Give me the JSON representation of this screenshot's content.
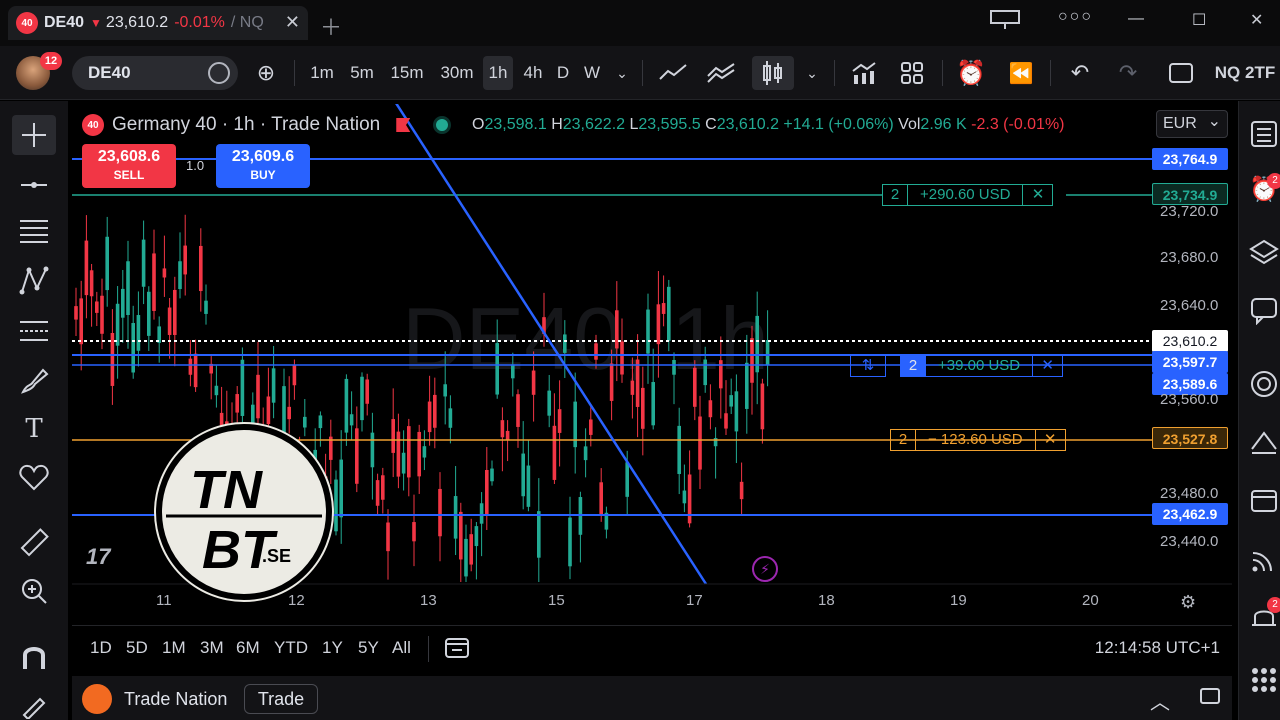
{
  "browser_tab": {
    "badge": "40",
    "symbol": "DE40",
    "price": "23,610.2",
    "change": "-0.01%",
    "suffix": "/ NQ"
  },
  "toolbar": {
    "notif_count": "12",
    "symbol": "DE40",
    "intervals": [
      "1m",
      "5m",
      "15m",
      "30m",
      "1h",
      "4h",
      "D",
      "W"
    ],
    "active_interval": "1h",
    "right_label": "NQ 2TF"
  },
  "chart": {
    "legend_badge": "40",
    "title": "Germany 40 · 1h · Trade Nation",
    "ohlc": {
      "o_label": "O",
      "o": "23,598.1",
      "h_label": "H",
      "h": "23,622.2",
      "l_label": "L",
      "l": "23,595.5",
      "c_label": "C",
      "c": "23,610.2",
      "chg": "+14.1 (+0.06%)",
      "vol_label": "Vol",
      "vol": "2.96 K",
      "vol_chg": "-2.3 (-0.01%)"
    },
    "currency": "EUR",
    "sell": {
      "price": "23,608.6",
      "label": "SELL"
    },
    "buy": {
      "price": "23,609.6",
      "label": "BUY"
    },
    "quantity": "1.0",
    "watermark": "DE40, 1h",
    "orders": [
      {
        "qty": "2",
        "pl": "+290.60 USD",
        "close": "✕",
        "color": "#22ab94"
      },
      {
        "qty": "2",
        "pl": "+39.00 USD",
        "close": "✕",
        "color": "#2962ff"
      },
      {
        "qty": "2",
        "pl": "− 123.60 USD",
        "close": "✕",
        "color": "#f0a030"
      }
    ],
    "price_tags": [
      {
        "value": "23,764.9",
        "color": "#2962ff"
      },
      {
        "value": "23,734.9",
        "color": "#1b4d3e"
      },
      {
        "value": "23,610.2",
        "color": "#ffffff"
      },
      {
        "value": "23,597.7",
        "color": "#2962ff"
      },
      {
        "value": "23,589.6",
        "color": "#2962ff"
      },
      {
        "value": "23,527.8",
        "color": "#f0a030"
      },
      {
        "value": "23,462.9",
        "color": "#2962ff"
      }
    ],
    "y_ticks": [
      "23,720.0",
      "23,680.0",
      "23,640.0",
      "23,560.0",
      "23,480.0",
      "23,440.0"
    ],
    "x_ticks": [
      "11",
      "12",
      "13",
      "15",
      "17",
      "18",
      "19",
      "20"
    ],
    "tv_logo": "17",
    "logo_text": {
      "line1": "TN",
      "line2": "BT",
      "suffix": ".SE"
    }
  },
  "range_bar": {
    "ranges": [
      "1D",
      "5D",
      "1M",
      "3M",
      "6M",
      "YTD",
      "1Y",
      "5Y",
      "All"
    ],
    "clock": "12:14:58 UTC+1"
  },
  "bottom_panel": {
    "broker": "Trade Nation",
    "trade_button": "Trade"
  },
  "right_sidebar": {
    "alerts_badge": "2",
    "notif_badge": "2"
  },
  "icons": [
    "crosshair-icon",
    "horizontal-line-icon",
    "lines-icon",
    "pattern-icon",
    "fib-icon",
    "brush-icon",
    "text-icon",
    "heart-icon",
    "ruler-icon",
    "zoom-icon",
    "magnet-icon",
    "lock-pencil-icon"
  ]
}
